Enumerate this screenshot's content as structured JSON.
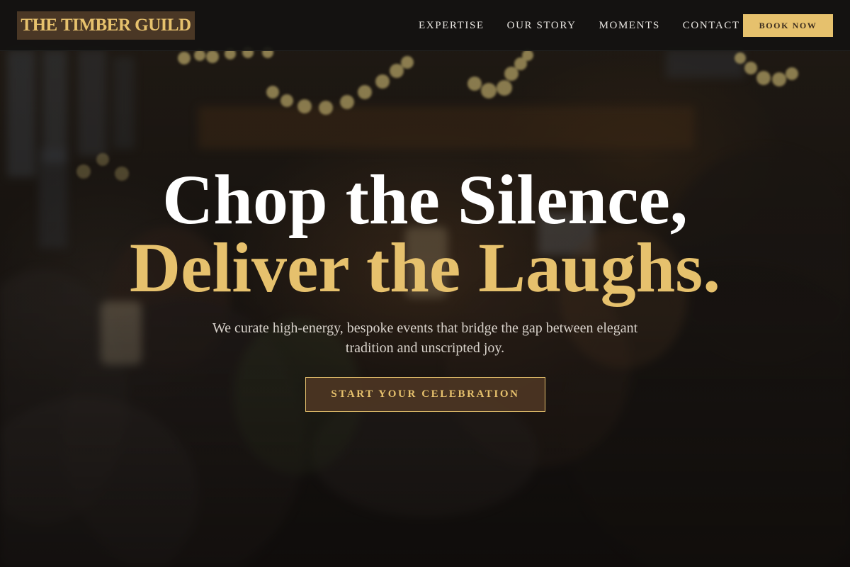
{
  "brand": {
    "logo_text": "THE TIMBER GUILD"
  },
  "nav": {
    "links": [
      {
        "label": "EXPERTISE"
      },
      {
        "label": "OUR STORY"
      },
      {
        "label": "MOMENTS"
      },
      {
        "label": "CONTACT"
      }
    ],
    "book_button": "BOOK NOW"
  },
  "hero": {
    "headline_line_1": "Chop the Silence,",
    "headline_line_2": "Deliver the Laughs.",
    "subtext": "We curate high-energy, bespoke events that bridge the gap between elegant tradition and unscripted joy.",
    "cta_label": "START YOUR CELEBRATION",
    "background_image": "blurred-wedding-reception-toast-photo"
  },
  "colors": {
    "accent_gold": "#e6c16d",
    "logo_bg": "#4a3725",
    "navbar_bg": "#141211",
    "text_light": "#e9e6e2"
  }
}
